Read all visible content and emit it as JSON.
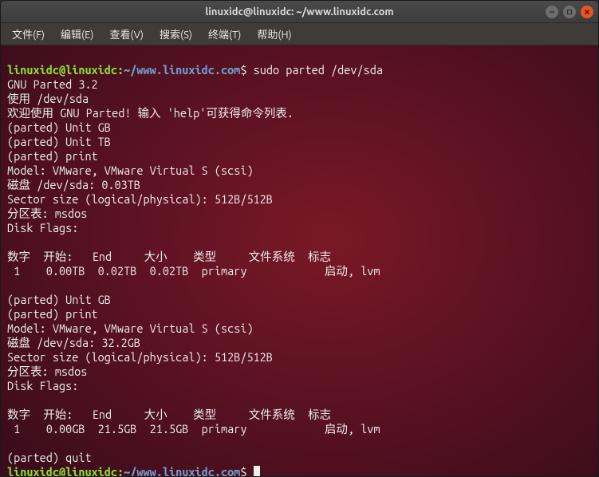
{
  "window": {
    "title": "linuxidc@linuxidc: ~/www.linuxidc.com"
  },
  "menu": {
    "file": "文件(F)",
    "edit": "编辑(E)",
    "view": "查看(V)",
    "search": "搜索(S)",
    "terminal": "终端(T)",
    "help": "帮助(H)"
  },
  "prompt": {
    "userhost": "linuxidc@linuxidc",
    "colon": ":",
    "path": "~/www.linuxidc.com",
    "dollar": "$ "
  },
  "lines": {
    "cmd1": "sudo parted /dev/sda",
    "l1": "GNU Parted 3.2",
    "l2": "使用 /dev/sda",
    "l3": "欢迎使用 GNU Parted! 输入 'help'可获得命令列表.",
    "l4": "(parted) Unit GB",
    "l5": "(parted) Unit TB",
    "l6": "(parted) print",
    "l7": "Model: VMware, VMware Virtual S (scsi)",
    "l8": "磁盘 /dev/sda: 0.03TB",
    "l9": "Sector size (logical/physical): 512B/512B",
    "l10": "分区表: msdos",
    "l11": "Disk Flags:",
    "l12": "",
    "l13": "数字  开始:   End     大小    类型     文件系统  标志",
    "l14": " 1    0.00TB  0.02TB  0.02TB  primary            启动, lvm",
    "l15": "",
    "l16": "(parted) Unit GB",
    "l17": "(parted) print",
    "l18": "Model: VMware, VMware Virtual S (scsi)",
    "l19": "磁盘 /dev/sda: 32.2GB",
    "l20": "Sector size (logical/physical): 512B/512B",
    "l21": "分区表: msdos",
    "l22": "Disk Flags:",
    "l23": "",
    "l24": "数字  开始:   End     大小    类型     文件系统  标志",
    "l25": " 1    0.00GB  21.5GB  21.5GB  primary            启动, lvm",
    "l26": "",
    "l27": "(parted) quit"
  }
}
